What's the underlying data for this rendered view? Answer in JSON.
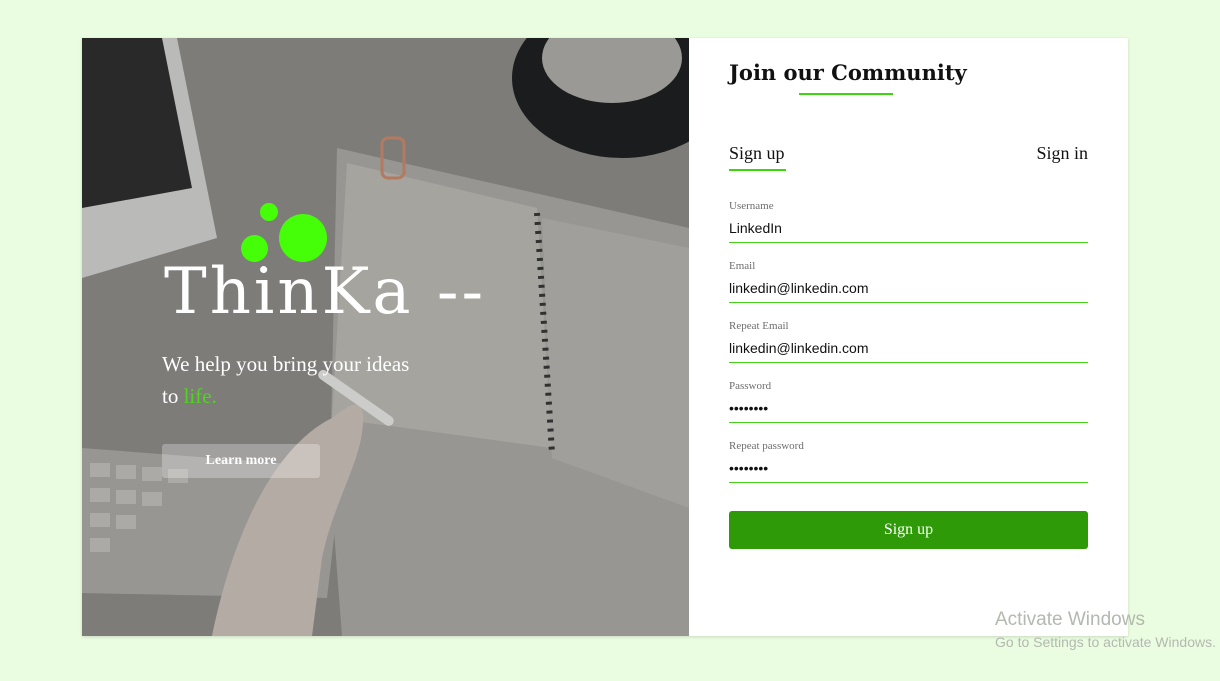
{
  "hero": {
    "brand": "ThinKa --",
    "tagline_start": "We help you bring your ideas to ",
    "tagline_accent": "life.",
    "learn_more": "Learn more"
  },
  "form": {
    "title": "Join our Community",
    "tabs": {
      "signup": "Sign up",
      "signin": "Sign in"
    },
    "fields": [
      {
        "label": "Username",
        "value": "LinkedIn",
        "type": "text"
      },
      {
        "label": "Email",
        "value": "linkedin@linkedin.com",
        "type": "email"
      },
      {
        "label": "Repeat Email",
        "value": "linkedin@linkedin.com",
        "type": "email"
      },
      {
        "label": "Password",
        "value": "••••••••",
        "type": "password"
      },
      {
        "label": "Repeat password",
        "value": "••••••••",
        "type": "password"
      }
    ],
    "submit": "Sign up"
  },
  "watermark": {
    "title": "Activate Windows",
    "subtitle": "Go to Settings to activate Windows."
  },
  "colors": {
    "accent": "#3cd50e",
    "button": "#2e9a08",
    "logo": "#44ff08",
    "page_bg": "#ebfde0"
  }
}
